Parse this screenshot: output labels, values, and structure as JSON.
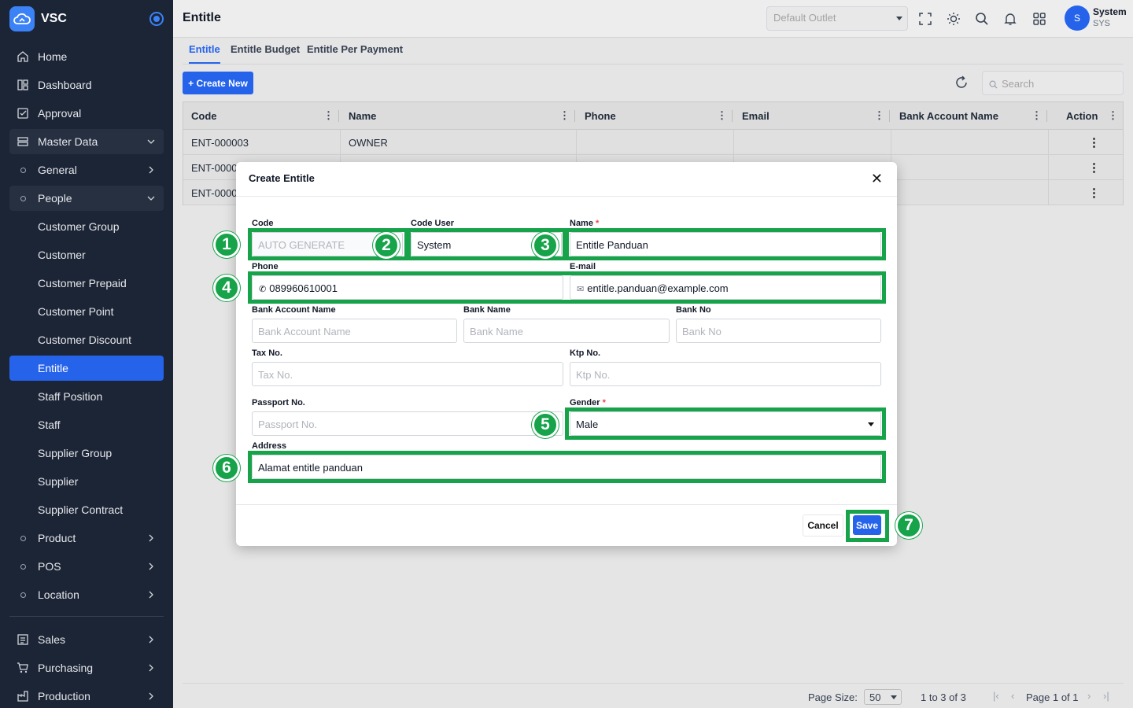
{
  "app": {
    "name": "VSC"
  },
  "sidebar": {
    "items": [
      {
        "label": "Home",
        "icon": "home-icon"
      },
      {
        "label": "Dashboard",
        "icon": "dashboard-icon"
      },
      {
        "label": "Approval",
        "icon": "approval-icon"
      },
      {
        "label": "Master Data",
        "icon": "master-data-icon"
      },
      {
        "label": "General"
      },
      {
        "label": "People"
      },
      {
        "label": "Customer Group"
      },
      {
        "label": "Customer"
      },
      {
        "label": "Customer Prepaid"
      },
      {
        "label": "Customer Point"
      },
      {
        "label": "Customer Discount"
      },
      {
        "label": "Entitle"
      },
      {
        "label": "Staff Position"
      },
      {
        "label": "Staff"
      },
      {
        "label": "Supplier Group"
      },
      {
        "label": "Supplier"
      },
      {
        "label": "Supplier Contract"
      },
      {
        "label": "Product"
      },
      {
        "label": "POS"
      },
      {
        "label": "Location"
      },
      {
        "label": "Sales",
        "icon": "sales-icon"
      },
      {
        "label": "Purchasing",
        "icon": "cart-icon"
      },
      {
        "label": "Production",
        "icon": "production-icon"
      }
    ]
  },
  "header": {
    "title": "Entitle",
    "outlet_placeholder": "Default Outlet",
    "user_initial": "S",
    "user_name": "System",
    "user_code": "SYS"
  },
  "tabs": [
    {
      "label": "Entitle"
    },
    {
      "label": "Entitle Budget"
    },
    {
      "label": "Entitle Per Payment"
    }
  ],
  "toolbar": {
    "create_label": "+ Create New",
    "search_placeholder": "Search"
  },
  "grid": {
    "columns": [
      "Code",
      "Name",
      "Phone",
      "Email",
      "Bank Account Name",
      "Action"
    ],
    "rows": [
      {
        "code": "ENT-000003",
        "name": "OWNER"
      },
      {
        "code": "ENT-0000"
      },
      {
        "code": "ENT-0000"
      }
    ]
  },
  "footer": {
    "page_size_label": "Page Size:",
    "page_size": "50",
    "range": "1 to 3 of 3",
    "page_label": "Page 1 of 1"
  },
  "modal": {
    "title": "Create Entitle",
    "fields": {
      "code": {
        "label": "Code",
        "placeholder": "AUTO GENERATE"
      },
      "code_user": {
        "label": "Code User",
        "value": "System"
      },
      "name": {
        "label": "Name",
        "value": "Entitle Panduan"
      },
      "phone": {
        "label": "Phone",
        "value": "089960610001"
      },
      "email": {
        "label": "E-mail",
        "value": "entitle.panduan@example.com"
      },
      "bank_account_name": {
        "label": "Bank Account Name",
        "placeholder": "Bank Account Name"
      },
      "bank_name": {
        "label": "Bank Name",
        "placeholder": "Bank Name"
      },
      "bank_no": {
        "label": "Bank No",
        "placeholder": "Bank No"
      },
      "tax_no": {
        "label": "Tax No.",
        "placeholder": "Tax No."
      },
      "ktp_no": {
        "label": "Ktp No.",
        "placeholder": "Ktp No."
      },
      "passport_no": {
        "label": "Passport No.",
        "placeholder": "Passport No."
      },
      "gender": {
        "label": "Gender",
        "value": "Male"
      },
      "address": {
        "label": "Address",
        "value": "Alamat entitle panduan"
      }
    },
    "required_mark": "*",
    "cancel_label": "Cancel",
    "save_label": "Save"
  },
  "annotations": [
    "1",
    "2",
    "3",
    "4",
    "5",
    "6",
    "7"
  ],
  "colors": {
    "accent": "#2563eb",
    "highlight": "#16a34a",
    "sidebar": "#1c2536"
  }
}
